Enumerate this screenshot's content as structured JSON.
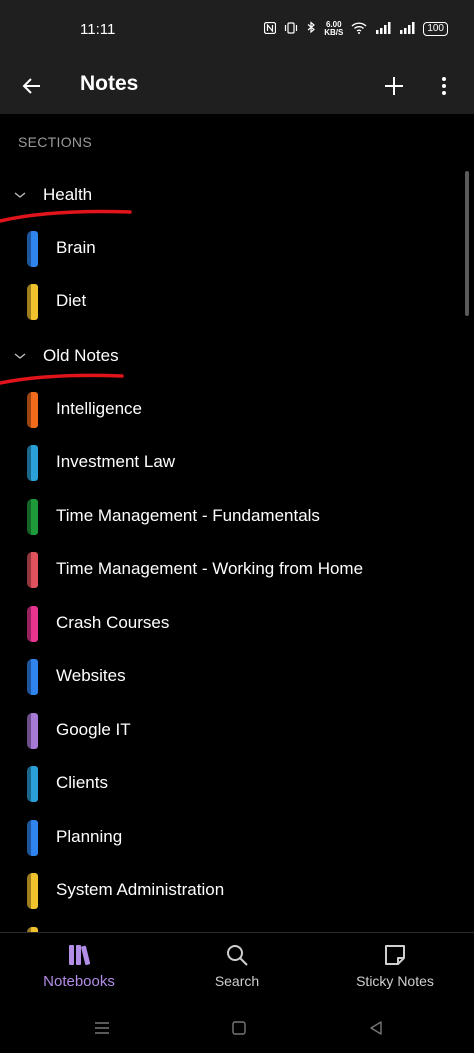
{
  "status_bar": {
    "time": "11:11",
    "net_speed_value": "6.00",
    "net_speed_unit": "KB/S",
    "battery": "100"
  },
  "app_bar": {
    "title": "Notes"
  },
  "sections_label": "SECTIONS",
  "groups": [
    {
      "name": "Health",
      "sections": [
        {
          "label": "Brain",
          "color": "#2f84f0"
        },
        {
          "label": "Diet",
          "color": "#f2c12e"
        }
      ]
    },
    {
      "name": "Old Notes",
      "sections": [
        {
          "label": "Intelligence",
          "color": "#f26b1d"
        },
        {
          "label": "Investment Law",
          "color": "#2a9fd8"
        },
        {
          "label": "Time Management - Fundamentals",
          "color": "#1f9a3a"
        },
        {
          "label": "Time Management - Working from Home",
          "color": "#e0525c"
        },
        {
          "label": "Crash Courses",
          "color": "#e8338f"
        },
        {
          "label": "Websites",
          "color": "#2f84f0"
        },
        {
          "label": "Google IT",
          "color": "#a679d6"
        },
        {
          "label": "Clients",
          "color": "#2a9fd8"
        },
        {
          "label": "Planning",
          "color": "#2f84f0"
        },
        {
          "label": "System Administration",
          "color": "#f2c12e"
        }
      ]
    }
  ],
  "annotation_color": "#e0141a",
  "bottom_nav": {
    "notebooks": "Notebooks",
    "search": "Search",
    "sticky_notes": "Sticky Notes"
  },
  "accent_color": "#b28ee6"
}
